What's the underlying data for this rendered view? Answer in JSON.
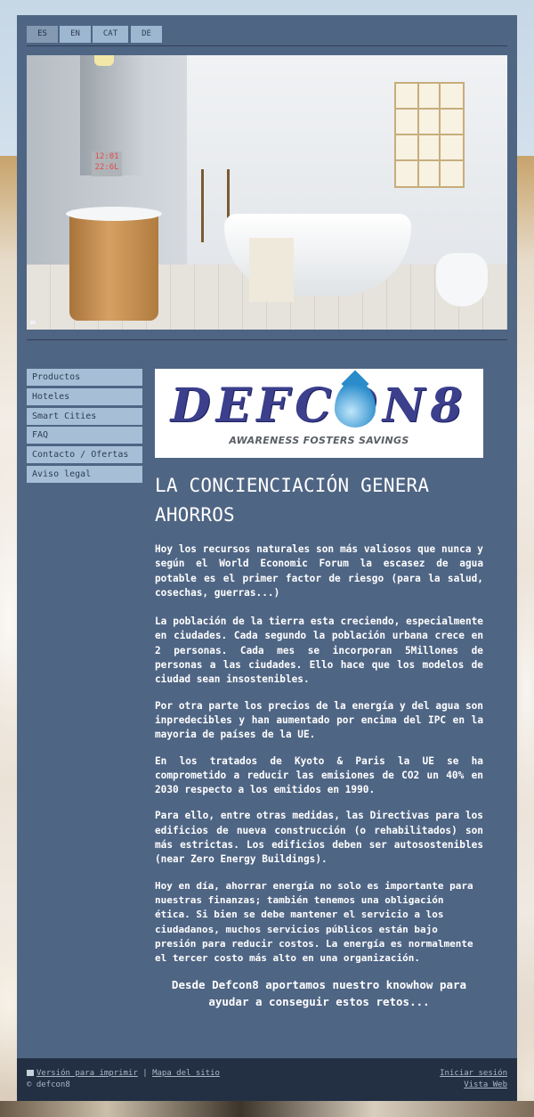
{
  "languages": [
    "ES",
    "EN",
    "CAT",
    "DE"
  ],
  "hero": {
    "clock_text": "12:01\n22:6L"
  },
  "nav": [
    "Productos",
    "Hoteles",
    "Smart Cities",
    "FAQ",
    "Contacto / Ofertas",
    "Aviso legal"
  ],
  "logo": {
    "wordmark": "DEFCON8",
    "tagline": "AWARENESS FOSTERS SAVINGS"
  },
  "content": {
    "title": "LA CONCIENCIACIÓN GENERA AHORROS",
    "paragraphs": [
      "Hoy los recursos naturales son más valiosos que nunca y según el World Economic Forum la escasez de agua potable es el primer factor de riesgo (para la salud, cosechas, guerras...)",
      "La población de la tierra esta creciendo, especialmente en ciudades. Cada segundo la población urbana crece en 2 personas. Cada mes se incorporan 5Millones de personas a las ciudades. Ello hace que los modelos de ciudad sean insostenibles.",
      "Por otra parte los precios de la energía y del agua son inpredecibles y han aumentado por encima del IPC en la mayoria de países de la UE.",
      "En los tratados de Kyoto & Paris la UE se ha comprometido a reducir las emisiones de CO2 un 40% en 2030 respecto a los emitidos en 1990.",
      "Para ello, entre otras medidas, las Directivas para los edificios de nueva construcción (o rehabilitados) son más estrictas. Los edificios deben ser autosostenibles (near Zero Energy Buildings).",
      "Hoy en día, ahorrar energía no solo es importante para nuestras finanzas; también tenemos una obligación ética. Si bien se debe mantener el servicio a los ciudadanos, muchos servicios públicos están bajo presión para reducir costos. La energía es normalmente el tercer costo más alto en una organización."
    ],
    "closing": "Desde Defcon8 aportamos nuestro knowhow para ayudar a conseguir estos retos..."
  },
  "footer": {
    "print_link": "Versión para imprimir",
    "separator": "|",
    "sitemap_link": "Mapa del sitio",
    "copyright": "© defcon8",
    "login_link": "Iniciar sesión",
    "web_view_link": "Vista Web"
  },
  "colors": {
    "panel": "#4f6584",
    "nav_item": "#a6bfd7",
    "footer": "#233044",
    "text": "#ffffff"
  }
}
